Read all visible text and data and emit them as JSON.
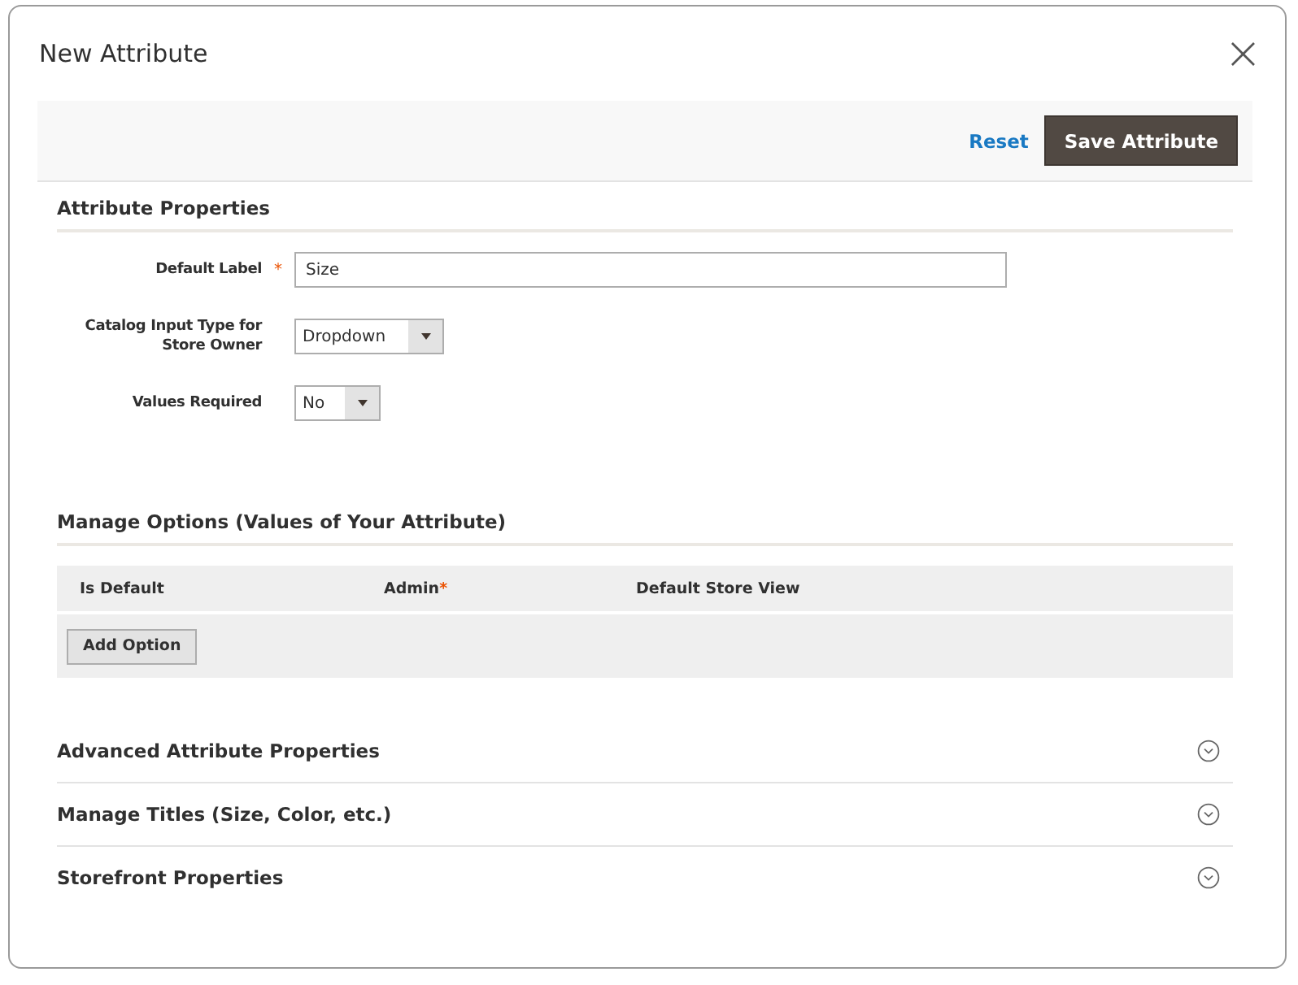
{
  "window": {
    "title": "New Attribute",
    "close": "×"
  },
  "toolbar": {
    "reset": "Reset",
    "save": "Save Attribute"
  },
  "required_mark": "*",
  "attribute_properties": {
    "title": "Attribute Properties",
    "fields": [
      {
        "kind": "text",
        "label": "Default Label",
        "required": true,
        "value": "Size"
      },
      {
        "kind": "select",
        "label": "Catalog Input Type for Store Owner",
        "required": false,
        "value": "Dropdown"
      },
      {
        "kind": "select",
        "label": "Values Required",
        "required": false,
        "value": "No"
      }
    ]
  },
  "manage_options": {
    "title": "Manage Options (Values of Your Attribute)",
    "columns": [
      {
        "label": "Is Default",
        "required": false
      },
      {
        "label": "Admin",
        "required": true
      },
      {
        "label": "Default Store View",
        "required": false
      }
    ],
    "add_button": "Add Option"
  },
  "sections": [
    {
      "title": "Advanced Attribute Properties",
      "expanded": false
    },
    {
      "title": "Manage Titles (Size, Color, etc.)",
      "expanded": false
    },
    {
      "title": "Storefront Properties",
      "expanded": false
    }
  ]
}
